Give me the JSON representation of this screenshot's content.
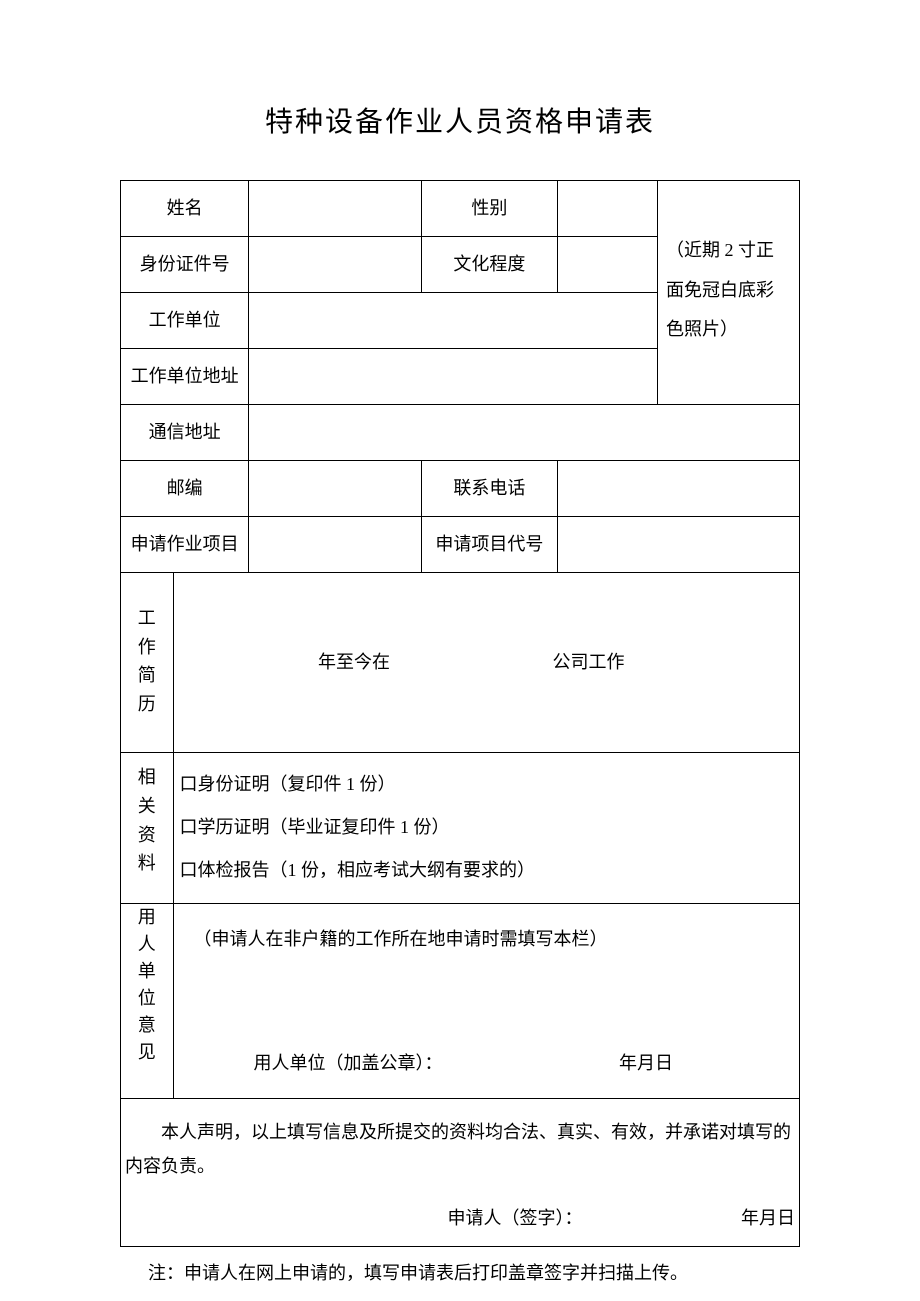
{
  "title": "特种设备作业人员资格申请表",
  "labels": {
    "name": "姓名",
    "gender": "性别",
    "id_no": "身份证件号",
    "education": "文化程度",
    "work_unit": "工作单位",
    "work_unit_addr": "工作单位地址",
    "mail_addr": "通信地址",
    "postcode": "邮编",
    "phone": "联系电话",
    "apply_item": "申请作业项目",
    "apply_code": "申请项目代号",
    "resume": "工作简历",
    "materials": "相关资料",
    "employer_opinion": "用人单位意见"
  },
  "photo_text": "（近期 2 寸正面免冠白底彩色照片）",
  "resume_text_before": "年至今在",
  "resume_text_after": "公司工作",
  "materials_items": [
    "口身份证明（复印件 1 份）",
    "口学历证明（毕业证复印件 1 份）",
    "口体检报告（1 份，相应考试大纲有要求的）"
  ],
  "employer_note": "（申请人在非户籍的工作所在地申请时需填写本栏）",
  "employer_seal": "用人单位（加盖公章）：",
  "date_label": "年月日",
  "declaration": "本人声明，以上填写信息及所提交的资料均合法、真实、有效，并承诺对填写的内容负责。",
  "applicant_sign": "申请人（签字）：",
  "footnote": "注：申请人在网上申请的，填写申请表后打印盖章签字并扫描上传。"
}
